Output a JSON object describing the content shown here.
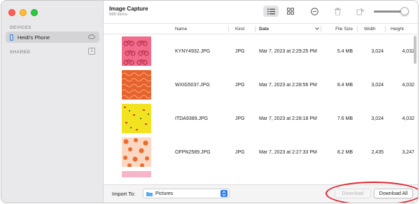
{
  "window": {
    "title": "Image Capture",
    "subtitle": "669 items"
  },
  "sidebar": {
    "devices_heading": "DEVICES",
    "device_name": "Heidi's Phone",
    "shared_heading": "SHARED",
    "shared_count": "1"
  },
  "toolbar": {
    "view_list": "list-view-icon",
    "view_grid": "grid-view-icon",
    "more": "ellipsis-circle-icon",
    "delete": "trash-icon",
    "rotate": "rotate-icon",
    "thumbnail_size_level": 0.88
  },
  "table": {
    "columns": [
      "Name",
      "Kind",
      "Date",
      "File Size",
      "Width",
      "Height"
    ],
    "rows": [
      {
        "name": "KYNY4932.JPG",
        "kind": "JPG",
        "date": "Mar 7, 2023 at 2:29:25 PM",
        "size": "5.4 MB",
        "width": "3,024",
        "height": "4,032",
        "thumb": "pink-bicycles"
      },
      {
        "name": "WXIG5037.JPG",
        "kind": "JPG",
        "date": "Mar 7, 2023 at 2:28:56 PM",
        "size": "8.4 MB",
        "width": "3,024",
        "height": "4,032",
        "thumb": "orange-pattern"
      },
      {
        "name": "ITDA9389.JPG",
        "kind": "JPG",
        "date": "Mar 7, 2023 at 2:28:18 PM",
        "size": "7.6 MB",
        "width": "3,024",
        "height": "4,032",
        "thumb": "yellow-pattern"
      },
      {
        "name": "OFPN2589.JPG",
        "kind": "JPG",
        "date": "Mar 7, 2023 at 2:27:33 PM",
        "size": "8.2 MB",
        "width": "2,435",
        "height": "3,247",
        "thumb": "peach-dots"
      }
    ]
  },
  "bottom": {
    "import_label": "Import To:",
    "import_destination": "Pictures",
    "download_label": "Download",
    "download_all_label": "Download All"
  },
  "colors": {
    "accent": "#2a7cf6",
    "highlight": "#e0202a",
    "sidebar_bg": "#e9e8ea"
  }
}
